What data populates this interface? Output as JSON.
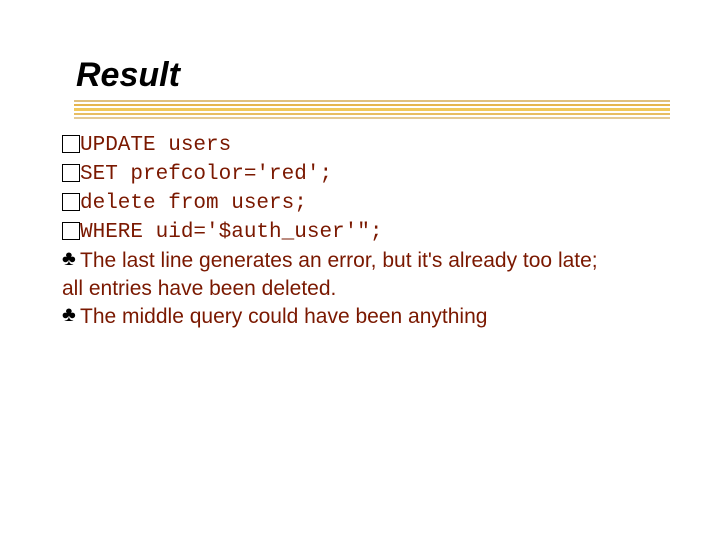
{
  "title": "Result",
  "code": {
    "l1": "UPDATE users",
    "l2": "SET prefcolor='red';",
    "l3": "delete from users;",
    "l4": "WHERE uid='$auth_user'\";"
  },
  "notes": {
    "n1a": "The last line generates an error, but it's already too late;",
    "n1b": "all entries have been deleted.",
    "n2": "The middle query could have been anything"
  }
}
